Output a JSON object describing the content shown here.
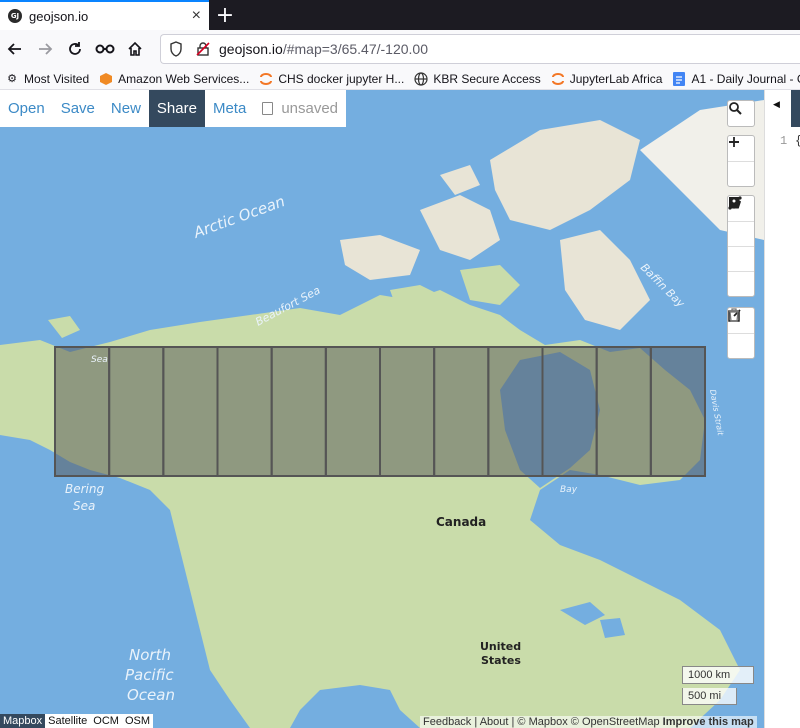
{
  "browser": {
    "tab_title": "geojson.io",
    "tab_favicon": "GJ",
    "close_glyph": "×",
    "newtab_glyph": "+",
    "url_host": "geojson.io",
    "url_path": "/#map=3/65.47/-120.00",
    "bookmarks": [
      {
        "label": "Most Visited",
        "icon": "gear-icon"
      },
      {
        "label": "Amazon Web Services...",
        "icon": "aws-icon"
      },
      {
        "label": "CHS docker jupyter H...",
        "icon": "jupyter-icon"
      },
      {
        "label": "KBR Secure Access",
        "icon": "globe-icon"
      },
      {
        "label": "JupyterLab Africa",
        "icon": "jupyter-icon"
      },
      {
        "label": "A1 - Daily Journal - G...",
        "icon": "docs-icon"
      }
    ]
  },
  "menu": {
    "open": "Open",
    "save": "Save",
    "new": "New",
    "share": "Share",
    "meta": "Meta",
    "status": "unsaved"
  },
  "map": {
    "labels": {
      "arctic_ocean": "Arctic Ocean",
      "beaufort_sea": "Beaufort Sea",
      "baffin_bay": "Baffin Bay",
      "bering_sea_1": "Bering",
      "bering_sea_2": "Sea",
      "canada": "Canada",
      "united_states_1": "United",
      "united_states_2": "States",
      "north_pacific_1": "North",
      "north_pacific_2": "Pacific",
      "north_pacific_3": "Ocean",
      "hudson_bay": "Bay",
      "davis_strait": "Davis Strait",
      "chukchi_sea": "Sea"
    },
    "grid_cells": 12,
    "scale_km": "1000 km",
    "scale_mi": "500 mi",
    "layers": [
      "Mapbox",
      "Satellite",
      "OCM",
      "OSM"
    ],
    "active_layer": "Mapbox",
    "attribution": {
      "feedback": "Feedback",
      "about": "About",
      "mapbox": "© Mapbox",
      "osm": "© OpenStreetMap",
      "improve": "Improve this map"
    }
  },
  "editor": {
    "line_number": "1",
    "code": "{"
  },
  "colors": {
    "water": "#74aee0",
    "land": "#c9dcaa",
    "ice": "#e8e4d6",
    "active": "#34495e",
    "link": "#3c8ac6"
  }
}
